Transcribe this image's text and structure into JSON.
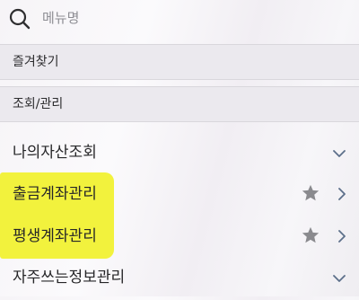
{
  "search": {
    "placeholder": "메뉴명",
    "icon": "search-icon"
  },
  "sections": [
    {
      "label": "즐겨찾기"
    },
    {
      "label": "조회/관리"
    }
  ],
  "menu_items": [
    {
      "label": "나의자산조회",
      "indicator": "chevron-down-icon",
      "highlighted": false
    },
    {
      "label": "출금계좌관리",
      "favorite": true,
      "indicator": "chevron-right-icon",
      "highlighted": true
    },
    {
      "label": "평생계좌관리",
      "favorite": true,
      "indicator": "chevron-right-icon",
      "highlighted": true
    },
    {
      "label": "자주쓰는정보관리",
      "indicator": "chevron-down-icon",
      "highlighted": false
    }
  ],
  "colors": {
    "highlight": "#f2f23d",
    "star": "#8a8a8e",
    "chevron": "#5c6f8a",
    "section_bg": "#ebe9ee"
  }
}
